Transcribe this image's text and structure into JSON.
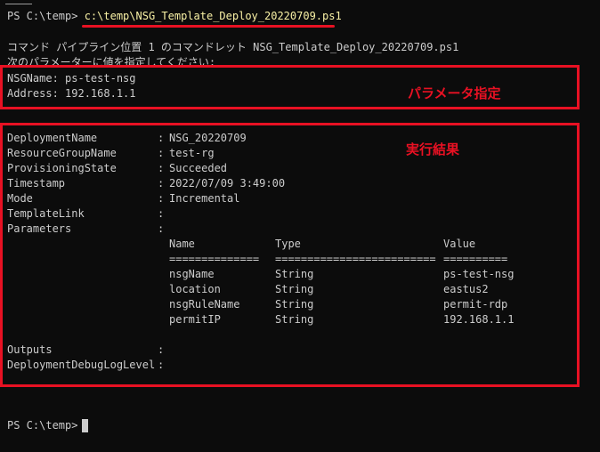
{
  "prompt_top": {
    "ps": "PS C:\\temp> ",
    "command": "c:\\temp\\NSG_Template_Deploy_20220709.ps1"
  },
  "messages": [
    "コマンド パイプライン位置 1 のコマンドレット NSG_Template_Deploy_20220709.ps1",
    "次のパラメーターに値を指定してください:"
  ],
  "param_inputs": [
    "NSGName: ps-test-nsg",
    "Address: 192.168.1.1"
  ],
  "annotations": {
    "params": "パラメータ指定",
    "result": "実行結果"
  },
  "result": {
    "fields": [
      {
        "name": "DeploymentName",
        "value": "NSG_20220709"
      },
      {
        "name": "ResourceGroupName",
        "value": "test-rg"
      },
      {
        "name": "ProvisioningState",
        "value": "Succeeded"
      },
      {
        "name": "Timestamp",
        "value": "2022/07/09 3:49:00"
      },
      {
        "name": "Mode",
        "value": "Incremental"
      },
      {
        "name": "TemplateLink",
        "value": ""
      },
      {
        "name": "Parameters",
        "value": ""
      }
    ],
    "parameters_table": {
      "headers": [
        "Name",
        "Type",
        "Value"
      ],
      "separators": [
        "==============",
        "=========================",
        "=========="
      ],
      "rows": [
        [
          "nsgName",
          "String",
          "ps-test-nsg"
        ],
        [
          "location",
          "String",
          "eastus2"
        ],
        [
          "nsgRuleName",
          "String",
          "permit-rdp"
        ],
        [
          "permitIP",
          "String",
          "192.168.1.1"
        ]
      ]
    },
    "fields_after": [
      {
        "name": "Outputs",
        "value": ""
      },
      {
        "name": "DeploymentDebugLogLevel",
        "value": ""
      }
    ]
  },
  "prompt_bottom": "PS C:\\temp> ",
  "colors": {
    "background": "#0c0c0c",
    "text": "#cccccc",
    "command": "#f9f1a5",
    "annotation": "#e81123"
  }
}
